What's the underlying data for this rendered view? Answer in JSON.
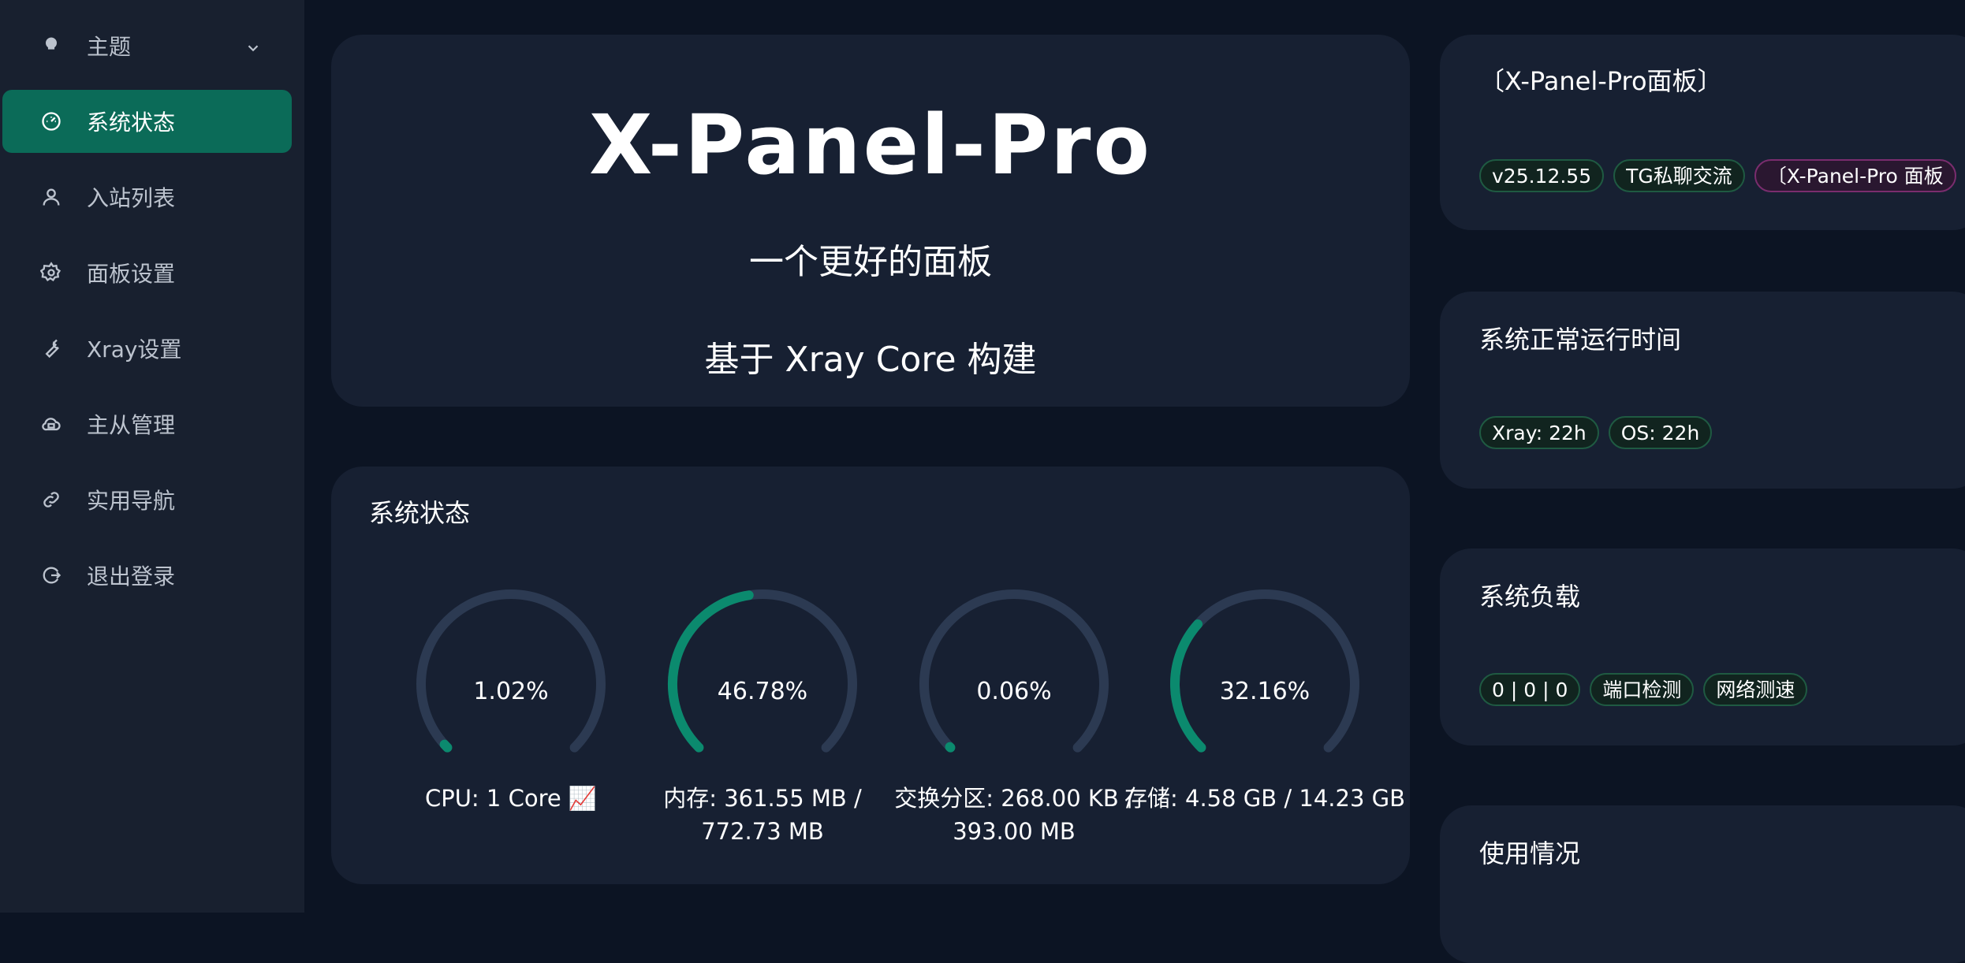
{
  "sidebar": {
    "items": [
      {
        "label": "主题",
        "icon": "bulb-icon"
      },
      {
        "label": "系统状态",
        "icon": "dashboard-icon"
      },
      {
        "label": "入站列表",
        "icon": "user-icon"
      },
      {
        "label": "面板设置",
        "icon": "gear-icon"
      },
      {
        "label": "Xray设置",
        "icon": "wrench-icon"
      },
      {
        "label": "主从管理",
        "icon": "cloud-icon"
      },
      {
        "label": "实用导航",
        "icon": "link-icon"
      },
      {
        "label": "退出登录",
        "icon": "logout-icon"
      }
    ],
    "active_index": 1
  },
  "hero": {
    "title": "X-Panel-Pro",
    "subtitle": "一个更好的面板",
    "tagline": "基于 Xray Core 构建"
  },
  "system_status": {
    "title": "系统状态",
    "gauges": [
      {
        "value_text": "1.02%",
        "percent": 1.02,
        "label": "CPU: 1 Core 📈"
      },
      {
        "value_text": "46.78%",
        "percent": 46.78,
        "label": "内存: 361.55 MB / 772.73 MB"
      },
      {
        "value_text": "0.06%",
        "percent": 0.06,
        "label": "交换分区: 268.00 KB / 393.00 MB"
      },
      {
        "value_text": "32.16%",
        "percent": 32.16,
        "label": "存储: 4.58 GB / 14.23 GB"
      }
    ]
  },
  "panel_info": {
    "title": "〔X-Panel-Pro面板〕",
    "tags": [
      "v25.12.55",
      "TG私聊交流",
      "〔X-Panel-Pro 面板"
    ]
  },
  "uptime": {
    "title": "系统正常运行时间",
    "tags": [
      "Xray: 22h",
      "OS: 22h"
    ]
  },
  "load": {
    "title": "系统负载",
    "tags": [
      "0 | 0 | 0",
      "端口检测",
      "网络测速"
    ]
  },
  "usage": {
    "title": "使用情况"
  },
  "colors": {
    "accent": "#0b8a6e",
    "gauge_track": "#2c3a52",
    "active_nav": "#0b6b58"
  }
}
